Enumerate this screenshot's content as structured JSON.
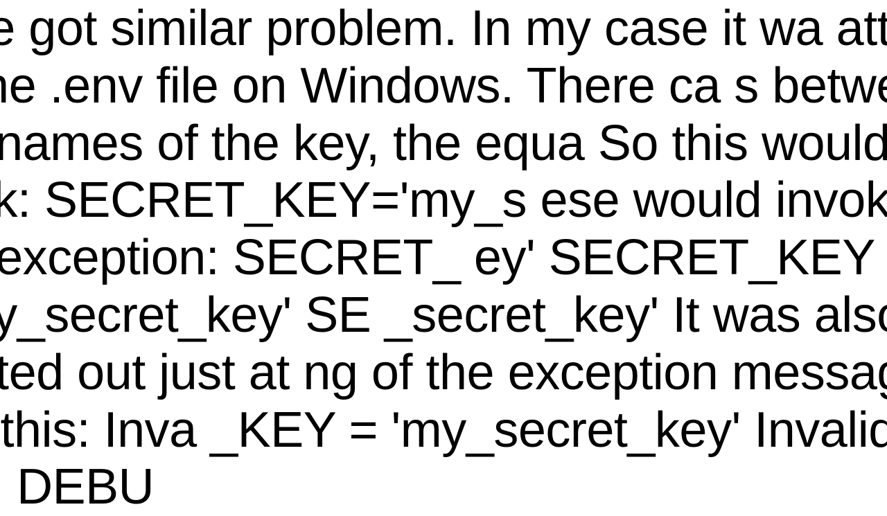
{
  "document": {
    "text": ": I've got similar problem. In my case it wa atting of the .env file on Windows. There ca s between the names of the key, the equa So this would work: SECRET_KEY='my_s ese would invoke the exception: SECRET_ ey'   SECRET_KEY ='my_secret_key'   SE _secret_key'  It was also printed out just at ng of the exception message like this: Inva _KEY = 'my_secret_key' Invalid line: DEBU"
  }
}
